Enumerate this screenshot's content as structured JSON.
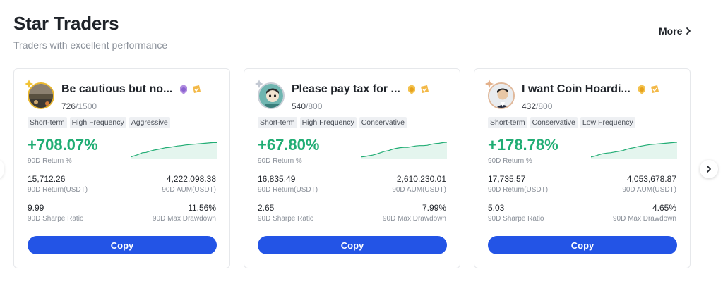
{
  "header": {
    "title": "Star Traders",
    "subtitle": "Traders with excellent performance",
    "more_label": "More"
  },
  "colors": {
    "accent": "#2354e6",
    "positive": "#21ad74",
    "gold": "#e9b62c"
  },
  "traders": [
    {
      "name": "Be cautious but no...",
      "followers": "726",
      "followers_max": "/1500",
      "tags": [
        "Short-term",
        "High Frequency",
        "Aggressive"
      ],
      "return_pct": "+708.07%",
      "return_label": "90D Return %",
      "return_usdt": "15,712.26",
      "return_usdt_label": "90D Return(USDT)",
      "aum": "4,222,098.38",
      "aum_label": "90D AUM(USDT)",
      "sharpe": "9.99",
      "sharpe_label": "90D Sharpe Ratio",
      "drawdown": "11.56%",
      "drawdown_label": "90D Max Drawdown",
      "copy_label": "Copy",
      "spark": [
        0.05,
        0.12,
        0.2,
        0.3,
        0.32,
        0.4,
        0.46,
        0.5,
        0.55,
        0.6,
        0.62,
        0.66,
        0.7,
        0.72,
        0.76,
        0.78,
        0.8,
        0.82,
        0.84,
        0.86,
        0.88,
        0.9,
        0.9
      ]
    },
    {
      "name": "Please pay tax for ...",
      "followers": "540",
      "followers_max": "/800",
      "tags": [
        "Short-term",
        "High Frequency",
        "Conservative"
      ],
      "return_pct": "+67.80%",
      "return_label": "90D Return %",
      "return_usdt": "16,835.49",
      "return_usdt_label": "90D Return(USDT)",
      "aum": "2,610,230.01",
      "aum_label": "90D AUM(USDT)",
      "sharpe": "2.65",
      "sharpe_label": "90D Sharpe Ratio",
      "drawdown": "7.99%",
      "drawdown_label": "90D Max Drawdown",
      "copy_label": "Copy",
      "spark": [
        0.05,
        0.08,
        0.12,
        0.16,
        0.22,
        0.3,
        0.38,
        0.42,
        0.5,
        0.56,
        0.6,
        0.62,
        0.62,
        0.66,
        0.7,
        0.72,
        0.72,
        0.74,
        0.8,
        0.84,
        0.86,
        0.9,
        0.92
      ]
    },
    {
      "name": "I want Coin Hoardi...",
      "followers": "432",
      "followers_max": "/800",
      "tags": [
        "Short-term",
        "Conservative",
        "Low Frequency"
      ],
      "return_pct": "+178.78%",
      "return_label": "90D Return %",
      "return_usdt": "17,735.57",
      "return_usdt_label": "90D Return(USDT)",
      "aum": "4,053,678.87",
      "aum_label": "90D AUM(USDT)",
      "sharpe": "5.03",
      "sharpe_label": "90D Sharpe Ratio",
      "drawdown": "4.65%",
      "drawdown_label": "90D Max Drawdown",
      "copy_label": "Copy",
      "spark": [
        0.05,
        0.1,
        0.18,
        0.24,
        0.28,
        0.3,
        0.34,
        0.38,
        0.42,
        0.5,
        0.56,
        0.6,
        0.66,
        0.7,
        0.74,
        0.78,
        0.8,
        0.82,
        0.84,
        0.86,
        0.88,
        0.9,
        0.92
      ]
    }
  ]
}
